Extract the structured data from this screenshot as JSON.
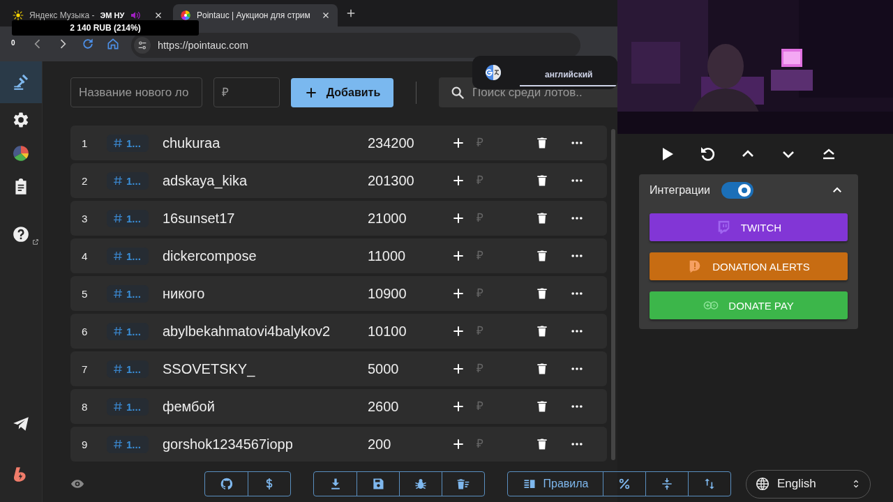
{
  "browser": {
    "tabs": [
      {
        "kind": "music",
        "title": "Яндекс Музыка -",
        "caption": "ЭМ НУ",
        "audio": true,
        "selected": false
      },
      {
        "kind": "wheel",
        "title": "Pointauc | Аукцион для стрим",
        "audio": false,
        "selected": true
      }
    ],
    "url": "https://pointauc.com"
  },
  "stream_overlay": {
    "counter": "0",
    "donation_total": "2 140 RUB (214%)"
  },
  "translate_popup": {
    "language": "английский"
  },
  "sidebar": {
    "items": [
      {
        "kind": "auction",
        "selected": true
      },
      {
        "kind": "settings",
        "selected": false
      },
      {
        "kind": "stats",
        "selected": false
      },
      {
        "kind": "history",
        "selected": false
      },
      {
        "kind": "help",
        "selected": false
      }
    ],
    "links": [
      {
        "kind": "telegram"
      },
      {
        "kind": "boosty"
      }
    ]
  },
  "lot_form": {
    "name_placeholder": "Название нового ло",
    "amount_placeholder": "₽",
    "add_button": "Добавить",
    "search_placeholder": "Поиск среди лотов.."
  },
  "lots": [
    {
      "rank": "1",
      "tag": "1...",
      "name": "chukuraa",
      "amount": "234200",
      "amount_placeholder": "₽"
    },
    {
      "rank": "2",
      "tag": "1...",
      "name": "adskaya_kika",
      "amount": "201300",
      "amount_placeholder": "₽"
    },
    {
      "rank": "3",
      "tag": "1...",
      "name": "16sunset17",
      "amount": "21000",
      "amount_placeholder": "₽"
    },
    {
      "rank": "4",
      "tag": "1...",
      "name": "dickercompose",
      "amount": "11000",
      "amount_placeholder": "₽"
    },
    {
      "rank": "5",
      "tag": "1...",
      "name": "никого",
      "amount": "10900",
      "amount_placeholder": "₽"
    },
    {
      "rank": "6",
      "tag": "1...",
      "name": "abylbekahmatovi4balykov2",
      "amount": "10100",
      "amount_placeholder": "₽"
    },
    {
      "rank": "7",
      "tag": "1...",
      "name": "SSOVETSKY_",
      "amount": "5000",
      "amount_placeholder": "₽"
    },
    {
      "rank": "8",
      "tag": "1...",
      "name": "фембой",
      "amount": "2600",
      "amount_placeholder": "₽"
    },
    {
      "rank": "9",
      "tag": "1...",
      "name": "gorshok1234567iopp",
      "amount": "200",
      "amount_placeholder": "₽"
    }
  ],
  "bottom_toolbar": {
    "groups": [
      [
        {
          "kind": "github"
        },
        {
          "kind": "dollar"
        }
      ],
      [
        {
          "kind": "download"
        },
        {
          "kind": "save"
        },
        {
          "kind": "bug"
        },
        {
          "kind": "clear"
        }
      ],
      [
        {
          "kind": "rules",
          "label": "Правила"
        },
        {
          "kind": "percent"
        },
        {
          "kind": "compress"
        },
        {
          "kind": "sort"
        }
      ]
    ]
  },
  "language_select": {
    "value": "English"
  },
  "integrations": {
    "title": "Интеграции",
    "enabled": true,
    "expanded": true,
    "services": [
      {
        "kind": "twitch",
        "label": "TWITCH",
        "color": "#8236d6"
      },
      {
        "kind": "donationalerts",
        "label": "DONATION ALERTS",
        "color": "#c76c12"
      },
      {
        "kind": "donatepay",
        "label": "DONATE PAY",
        "color": "#3cb64a"
      }
    ]
  }
}
